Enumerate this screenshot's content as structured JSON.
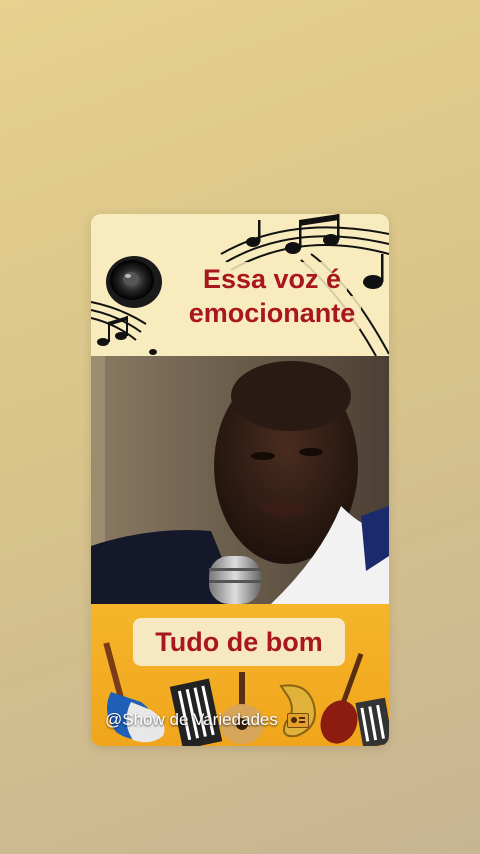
{
  "headline": {
    "line1": "Essa voz é",
    "line2": "emocionante"
  },
  "caption": "Tudo de bom",
  "watermark": "@Show de Variedades",
  "icons": [
    "speaker-icon",
    "music-notes-icon",
    "radio-icon"
  ],
  "colors": {
    "headline": "#a8161e",
    "bottom_band": "#f5b52b",
    "top_band": "#f8ebbd"
  }
}
